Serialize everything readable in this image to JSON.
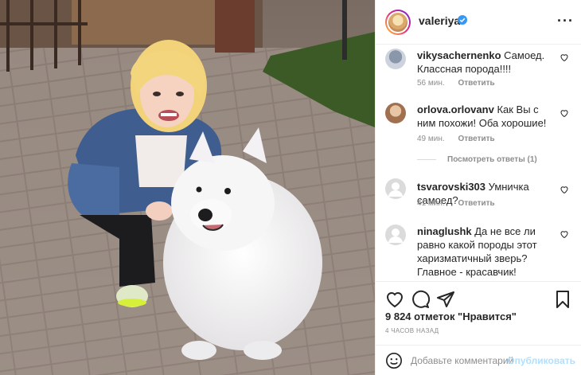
{
  "post": {
    "photo_alt": "",
    "author": "valeriya",
    "verified": true
  },
  "comments": [
    {
      "user": "vikysachernenko",
      "text": "Самоед. Классная порода!!!!",
      "time": "56 мин.",
      "reply": "Ответить"
    },
    {
      "user": "orlova.orlovanv",
      "text": "Как Вы с ним похожи! Оба хорошие!",
      "time": "49 мин.",
      "reply": "Ответить"
    },
    {
      "user": "tsvarovski303",
      "text": "Умничка самоед?",
      "time": "41 мин.",
      "reply": "Ответить"
    },
    {
      "user": "ninaglushk",
      "text": "Да не все ли равно какой породы этот харизматичный зверь? Главное - красавчик!",
      "time": "",
      "reply": ""
    }
  ],
  "view_replies": "Посмотреть ответы (1)",
  "likes_text": "9 824 отметок \"Нравится\"",
  "timestamp": "4 ЧАСОВ НАЗАД",
  "add_comment": {
    "placeholder": "Добавьте комментарий...",
    "post_label": "Опубликовать"
  },
  "colors": {
    "verified": "#3897f0",
    "muted": "#8e8e8e",
    "post_button": "#b2dffc"
  }
}
